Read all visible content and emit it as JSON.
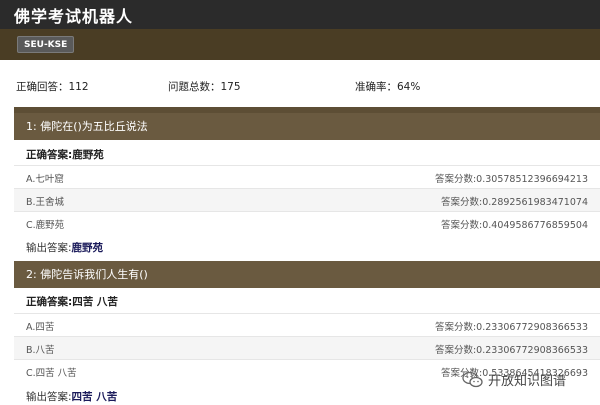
{
  "app": {
    "title": "佛学考试机器人",
    "badge": "SEU-KSE"
  },
  "stats": {
    "correct": "正确回答：112",
    "total": "问题总数：175",
    "accuracy": "准确率：64%"
  },
  "questions": [
    {
      "header": "1: 佛陀在()为五比丘说法",
      "correct_answer": "正确答案:鹿野苑",
      "options": [
        {
          "label": "A.七叶窟",
          "score": "答案分数:0.30578512396694213"
        },
        {
          "label": "B.王舍城",
          "score": "答案分数:0.2892561983471074"
        },
        {
          "label": "C.鹿野苑",
          "score": "答案分数:0.4049586776859504"
        }
      ],
      "output_label": "输出答案:",
      "output_value": "鹿野苑"
    },
    {
      "header": "2: 佛陀告诉我们人生有()",
      "correct_answer": "正确答案:四苦 八苦",
      "options": [
        {
          "label": "A.四苦",
          "score": "答案分数:0.23306772908366533"
        },
        {
          "label": "B.八苦",
          "score": "答案分数:0.23306772908366533"
        },
        {
          "label": "C.四苦 八苦",
          "score": "答案分数:0.5338645418326693"
        }
      ],
      "output_label": "输出答案:",
      "output_value": "四苦 八苦"
    }
  ],
  "watermark": {
    "text": "开放知识图谱",
    "icon": "wechat-icon"
  }
}
